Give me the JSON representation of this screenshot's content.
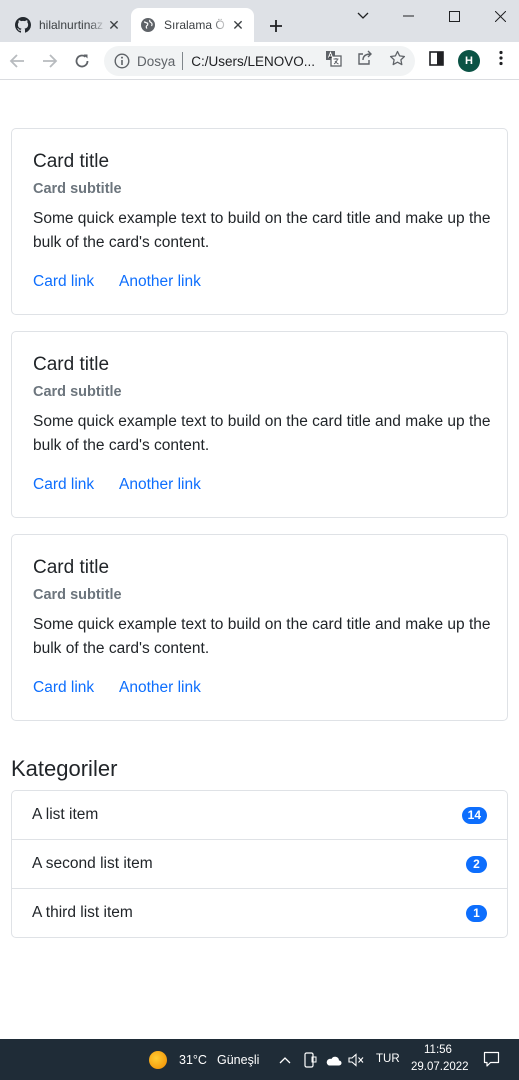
{
  "browser": {
    "tabs": [
      {
        "title": "hilalnurtinaz",
        "icon": "github-icon",
        "active": false
      },
      {
        "title": "Sıralama Ö",
        "icon": "globe-icon",
        "active": true
      }
    ],
    "address": {
      "chip": "Dosya",
      "url": "C:/Users/LENOVO..."
    },
    "profile_initial": "H"
  },
  "cards": [
    {
      "title": "Card title",
      "subtitle": "Card subtitle",
      "text": "Some quick example text to build on the card title and make up the bulk of the card's content.",
      "link1": "Card link",
      "link2": "Another link"
    },
    {
      "title": "Card title",
      "subtitle": "Card subtitle",
      "text": "Some quick example text to build on the card title and make up the bulk of the card's content.",
      "link1": "Card link",
      "link2": "Another link"
    },
    {
      "title": "Card title",
      "subtitle": "Card subtitle",
      "text": "Some quick example text to build on the card title and make up the bulk of the card's content.",
      "link1": "Card link",
      "link2": "Another link"
    }
  ],
  "categories": {
    "heading": "Kategoriler",
    "items": [
      {
        "label": "A list item",
        "badge": "14"
      },
      {
        "label": "A second list item",
        "badge": "2"
      },
      {
        "label": "A third list item",
        "badge": "1"
      }
    ]
  },
  "taskbar": {
    "weather_temp": "31°C",
    "weather_desc": "Güneşli",
    "language": "TUR",
    "time": "11:56",
    "date": "29.07.2022"
  },
  "colors": {
    "primary": "#0d6efd",
    "muted": "#6c757d",
    "taskbar": "#1f2c37",
    "tabstrip": "#dee1e6"
  }
}
